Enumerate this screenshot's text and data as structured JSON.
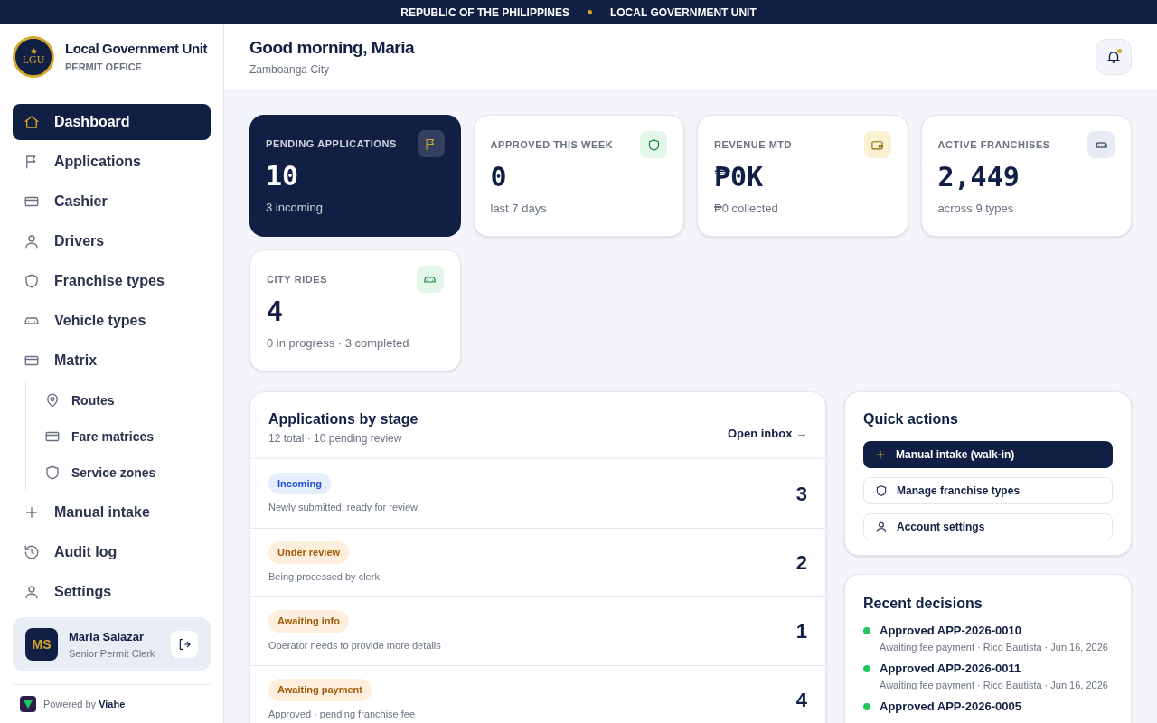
{
  "top_bar": [
    "REPUBLIC OF THE PHILIPPINES",
    "LOCAL GOVERNMENT UNIT"
  ],
  "brand": {
    "logo": "LGU",
    "title": "Local Government Unit",
    "subtitle": "PERMIT OFFICE"
  },
  "header": {
    "greeting": "Good morning, Maria",
    "city": "Zamboanga City",
    "notifications_unread": true
  },
  "sidebar": {
    "items": [
      {
        "label": "Dashboard",
        "selected": true
      },
      {
        "label": "Applications",
        "selected": false
      },
      {
        "label": "Cashier",
        "selected": false
      },
      {
        "label": "Drivers",
        "selected": false
      },
      {
        "label": "Franchise types",
        "selected": false
      },
      {
        "label": "Vehicle types",
        "selected": false
      },
      {
        "label": "Matrix",
        "selected": false,
        "children": [
          {
            "label": "Routes",
            "selected": false
          },
          {
            "label": "Fare matrices",
            "selected": false
          },
          {
            "label": "Service zones",
            "selected": false
          }
        ]
      },
      {
        "label": "Manual intake",
        "selected": false
      },
      {
        "label": "Audit log",
        "selected": false
      },
      {
        "label": "Settings",
        "selected": false
      }
    ],
    "user": {
      "initials": "MS",
      "name": "Maria Salazar",
      "role": "Senior Permit Clerk"
    },
    "powered_by": "Powered by **Viahe**"
  },
  "stats": [
    {
      "kind": "pending",
      "label": "PENDING APPLICATIONS",
      "value": "10",
      "note": "3 incoming"
    },
    {
      "kind": "approved",
      "label": "APPROVED THIS WEEK",
      "value": "0",
      "note": "last 7 days"
    },
    {
      "kind": "revenue",
      "label": "REVENUE MTD",
      "value": "₱0K",
      "note": "₱0 collected"
    },
    {
      "kind": "franchises",
      "label": "ACTIVE FRANCHISES",
      "value": "2,449",
      "note": "across 9 types"
    },
    {
      "kind": "rides",
      "label": "CITY RIDES",
      "value": "4",
      "note": "0 in progress · 3 completed"
    }
  ],
  "stages": {
    "title": "Applications by stage",
    "subtitle": "12 total · 10 pending review",
    "link": "Open inbox →",
    "rows": [
      {
        "kind": "info",
        "badge": "Incoming",
        "description": "Newly submitted, ready for review",
        "count": "3"
      },
      {
        "kind": "warning",
        "badge": "Under review",
        "description": "Being processed by clerk",
        "count": "2"
      },
      {
        "kind": "warning",
        "badge": "Awaiting info",
        "description": "Operator needs to provide more details",
        "count": "1"
      },
      {
        "kind": "warning",
        "badge": "Awaiting payment",
        "description": "Approved · pending franchise fee",
        "count": "4"
      }
    ]
  },
  "quick_actions": {
    "title": "Quick actions",
    "actions": [
      {
        "kind": "primary",
        "label": "Manual intake (walk-in)"
      },
      {
        "kind": "franchise",
        "label": "Manage franchise types"
      },
      {
        "kind": "account",
        "label": "Account settings"
      }
    ]
  },
  "recent_decisions": {
    "title": "Recent decisions",
    "items": [
      {
        "color": "#22c55e",
        "title": "Approved APP-2026-0010",
        "detail": "Awaiting fee payment · Rico Bautista · Jun 16, 2026"
      },
      {
        "color": "#22c55e",
        "title": "Approved APP-2026-0011",
        "detail": "Awaiting fee payment · Rico Bautista · Jun 16, 2026"
      },
      {
        "color": "#22c55e",
        "title": "Approved APP-2026-0005"
      }
    ]
  }
}
